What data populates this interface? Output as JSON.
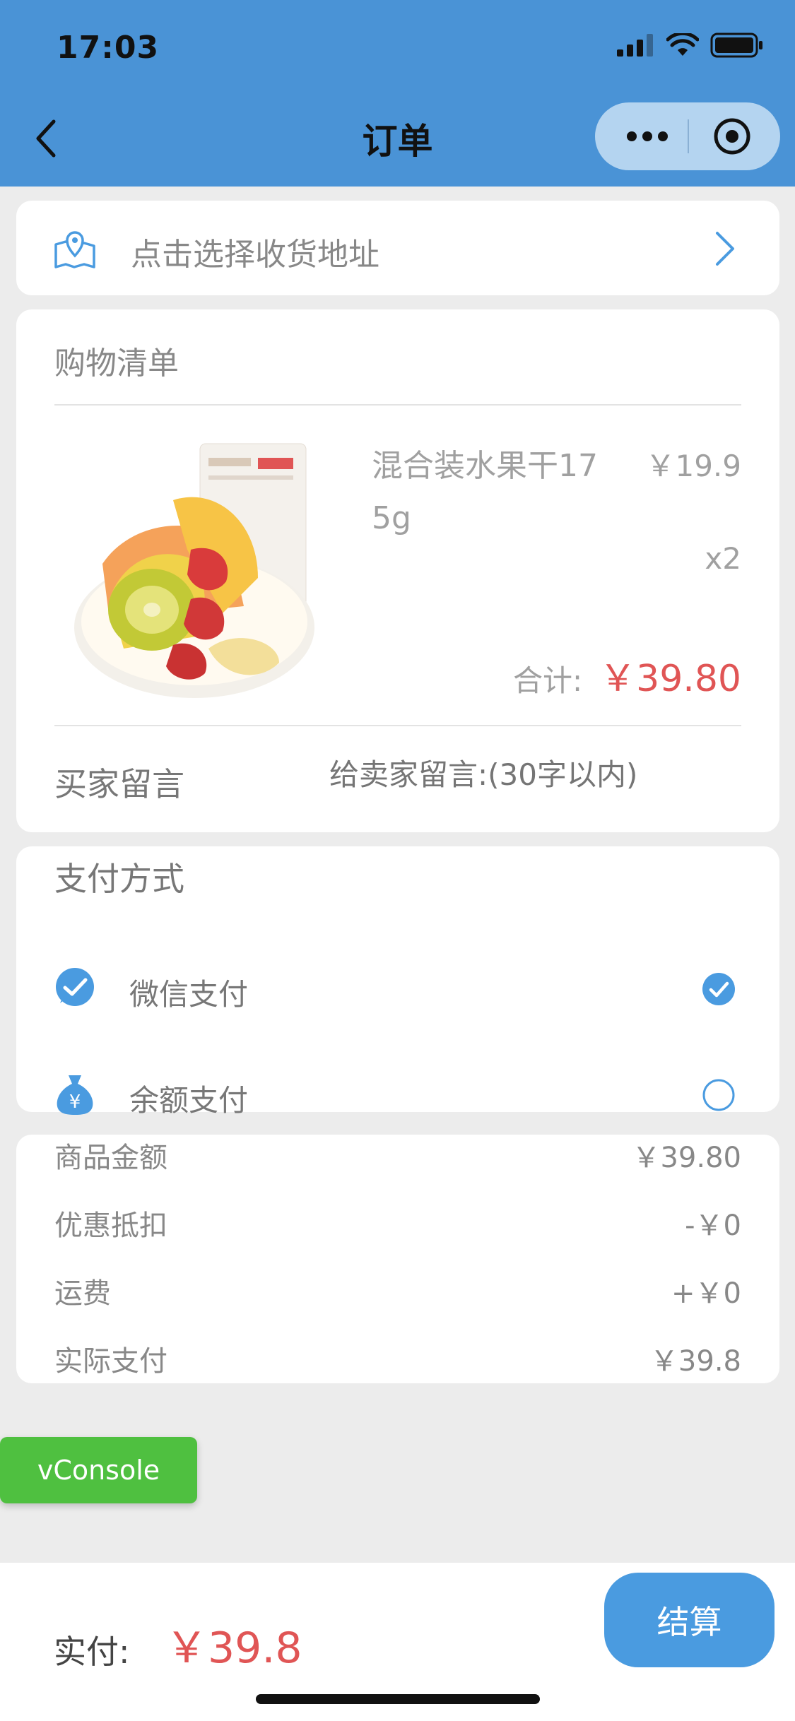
{
  "status_bar": {
    "time": "17:03"
  },
  "nav": {
    "title": "订单"
  },
  "address": {
    "placeholder": "点击选择收货地址"
  },
  "cart": {
    "title": "购物清单",
    "item": {
      "name": "混合装水果干175g",
      "price": "￥19.9",
      "qty": "x2"
    },
    "subtotal_label": "合计:",
    "subtotal_value": "￥39.80",
    "message_label": "买家留言",
    "message_placeholder": "给卖家留言:(30字以内)"
  },
  "payment": {
    "title": "支付方式",
    "options": [
      {
        "label": "微信支付",
        "icon": "wechat-pay-icon",
        "selected": true
      },
      {
        "label": "余额支付",
        "icon": "balance-icon",
        "selected": false
      }
    ]
  },
  "summary": {
    "rows": [
      {
        "label": "商品金额",
        "value": "￥39.80"
      },
      {
        "label": "优惠抵扣",
        "value": "-￥0"
      },
      {
        "label": "运费",
        "value": "+￥0"
      },
      {
        "label": "实际支付",
        "value": "￥39.8"
      }
    ]
  },
  "vconsole": {
    "label": "vConsole"
  },
  "footer": {
    "label": "实付:",
    "value": "￥39.8",
    "checkout_label": "结算"
  },
  "colors": {
    "header": "#4a93d6",
    "accent": "#4a9be0",
    "price_red": "#e05555",
    "vconsole_green": "#4fc040"
  }
}
